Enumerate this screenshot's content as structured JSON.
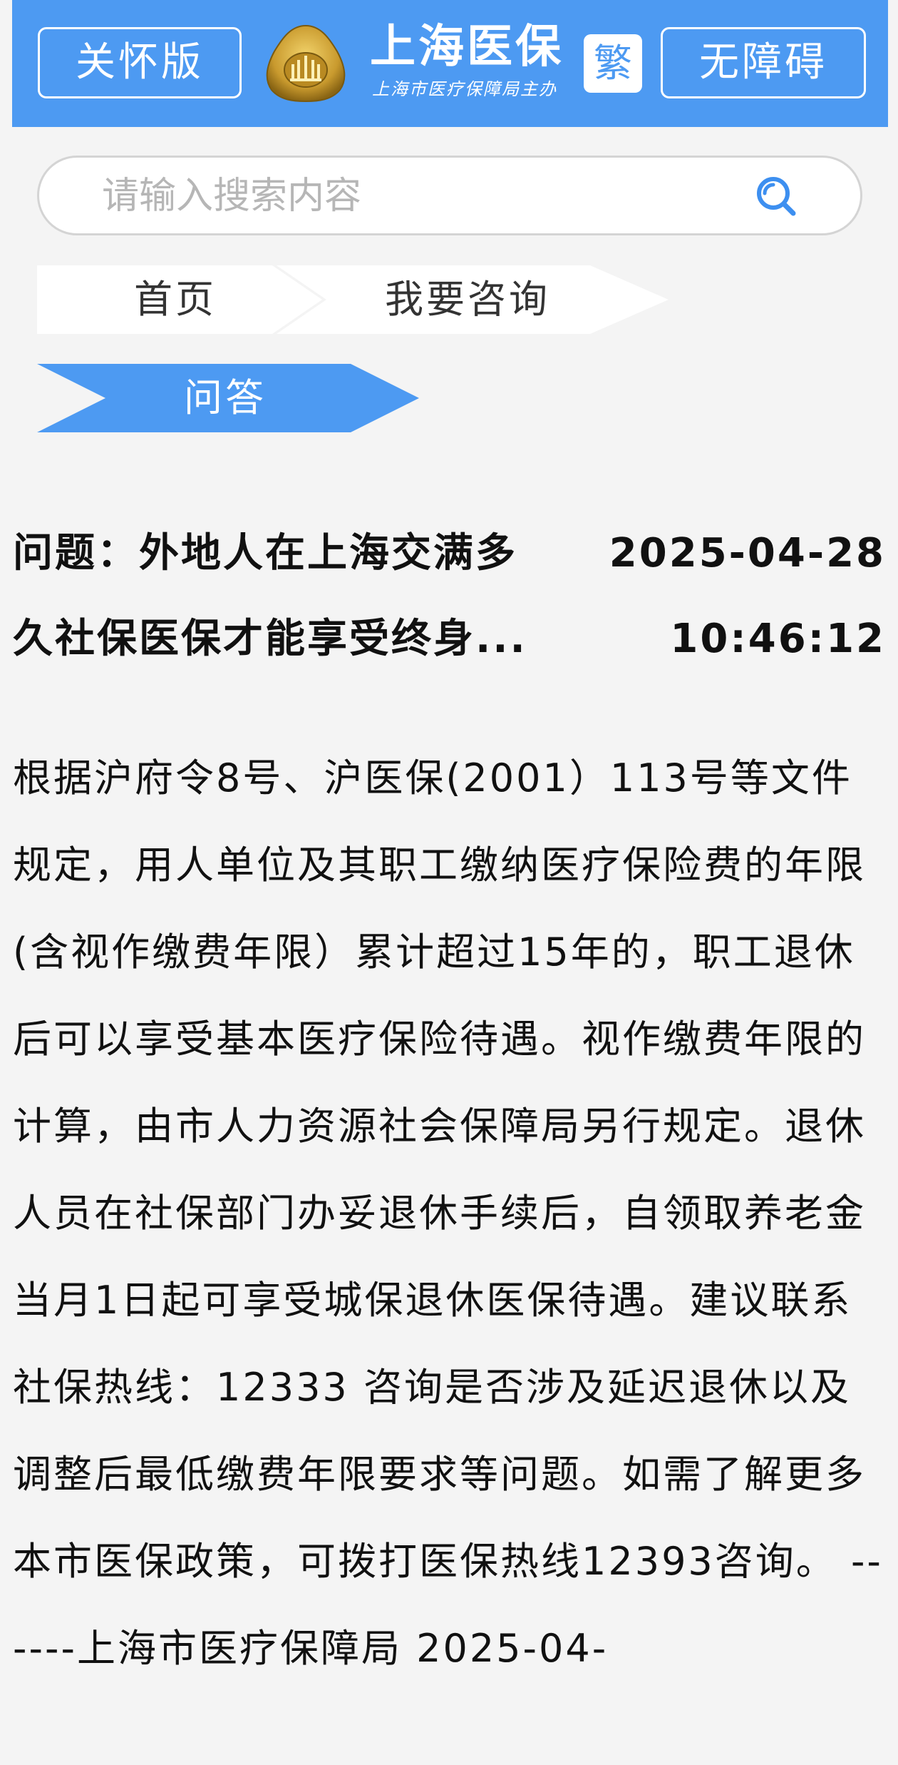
{
  "header": {
    "care_label": "关怀版",
    "brand_title": "上海医保",
    "brand_sub": "上海市医疗保障局主办",
    "trad_label": "繁",
    "access_label": "无障碍",
    "bg_color": "#4d9af2"
  },
  "search": {
    "placeholder": "请输入搜索内容",
    "value": ""
  },
  "breadcrumb": {
    "items": [
      {
        "label": "首页",
        "active": false
      },
      {
        "label": "我要咨询",
        "active": false
      },
      {
        "label": "问答",
        "active": true
      }
    ],
    "active_color": "#4d9af2"
  },
  "question": {
    "title_line1": "问题：外地人在上海交满多",
    "title_line2": "久社保医保才能享受终身...",
    "date": "2025-04-28",
    "time": "10:46:12"
  },
  "answer": {
    "text": "根据沪府令8号、沪医保(2001）113号等文件规定，用人单位及其职工缴纳医疗保险费的年限(含视作缴费年限）累计超过15年的，职工退休后可以享受基本医疗保险待遇。视作缴费年限的计算，由市人力资源社会保障局另行规定。退休人员在社保部门办妥退休手续后，自领取养老金当月1日起可享受城保退休医保待遇。建议联系社保热线：12333 咨询是否涉及延迟退休以及调整后最低缴费年限要求等问题。如需了解更多本市医保政策，可拨打医保热线12393咨询。 ------上海市医疗保障局 2025-04-"
  }
}
